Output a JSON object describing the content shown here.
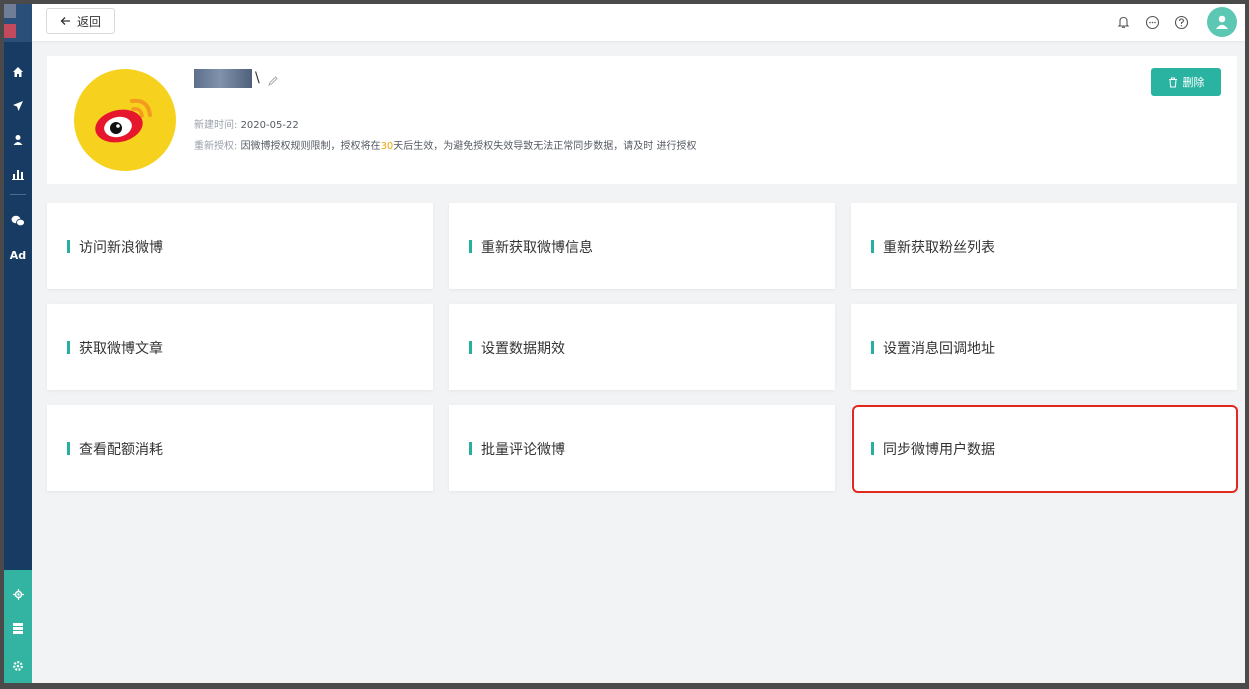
{
  "topbar": {
    "back_label": "返回"
  },
  "sidebar": {
    "ad_label": "Ad"
  },
  "profile": {
    "name_suffix": "\\",
    "created_label": "新建时间: ",
    "created_value": "2020-05-22",
    "reauth_label": "重新授权: ",
    "reauth_pre": "因微博授权规则限制，授权将在",
    "reauth_days": "30",
    "reauth_post": "天后生效，为避免授权失效导致无法正常同步数据，请及时 进行授权",
    "delete_label": "删除"
  },
  "actions": [
    {
      "label": "访问新浪微博"
    },
    {
      "label": "重新获取微博信息"
    },
    {
      "label": "重新获取粉丝列表"
    },
    {
      "label": "获取微博文章"
    },
    {
      "label": "设置数据期效"
    },
    {
      "label": "设置消息回调地址"
    },
    {
      "label": "查看配额消耗"
    },
    {
      "label": "批量评论微博"
    },
    {
      "label": "同步微博用户数据"
    }
  ],
  "colors": {
    "accent": "#2ab3a1",
    "sidebar": "#173b63",
    "highlight": "#e1291f",
    "warning_number": "#f0a500"
  },
  "icons": [
    "home-icon",
    "send-icon",
    "user-icon",
    "bar-chart-icon",
    "wechat-icon",
    "bell-icon",
    "message-icon",
    "help-icon",
    "avatar-icon",
    "trash-icon",
    "edit-icon",
    "brain-icon",
    "database-icon",
    "gear-icon"
  ]
}
